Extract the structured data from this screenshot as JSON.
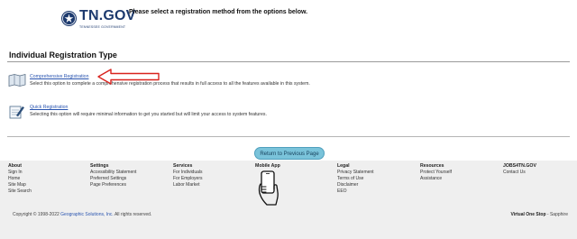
{
  "header": {
    "logo_text": "TN.GOV",
    "logo_subtext": "TENNESSEE GOVERNMENT",
    "instruction": "Please select a registration method from the options below."
  },
  "section": {
    "title": "Individual Registration Type"
  },
  "options": [
    {
      "link": "Comprehensive Registration",
      "description": "Select this option to complete a comprehensive registration process that results in full access to all the features available in this system."
    },
    {
      "link": "Quick Registration",
      "description": "Selecting this option will require minimal information to get you started but will limit your access to system features."
    }
  ],
  "return_button": "Return to Previous Page",
  "footer": {
    "columns": [
      {
        "title": "About",
        "links": [
          "Sign In",
          "Home",
          "Site Map",
          "Site Search"
        ]
      },
      {
        "title": "Settings",
        "links": [
          "Accessibility Statement",
          "Preferred Settings",
          "Page Preferences"
        ]
      },
      {
        "title": "Services",
        "links": [
          "For Individuals",
          "For Employers",
          "Labor Market"
        ]
      },
      {
        "title": "Mobile App",
        "links": []
      },
      {
        "title": "Legal",
        "links": [
          "Privacy Statement",
          "Terms of Use",
          "Disclaimer",
          "EEO"
        ]
      },
      {
        "title": "Resources",
        "links": [
          "Protect Yourself",
          "Assistance"
        ]
      },
      {
        "title": "JOBS4TN.GOV",
        "links": [
          "Contact Us"
        ]
      }
    ],
    "copyright_prefix": "Copyright © 1998-2022",
    "copyright_company": "Geographic Solutions, Inc.",
    "copyright_suffix": "All rights reserved.",
    "vos_brand": "Virtual One Stop",
    "vos_suffix": "- Sapphire"
  },
  "colors": {
    "accent": "#2a55b0",
    "button": "#7ac3da",
    "arrow": "#d9231e",
    "footer_bg": "#efefef"
  }
}
